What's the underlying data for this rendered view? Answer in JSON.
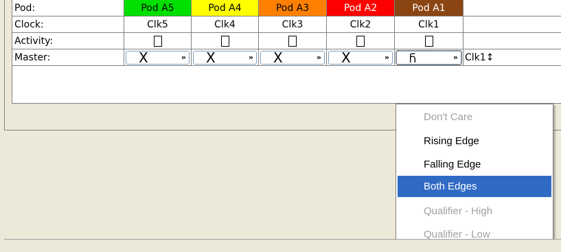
{
  "labels": {
    "pod": "Pod:",
    "clock": "Clock:",
    "activity": "Activity:",
    "master": "Master:"
  },
  "pods": [
    {
      "name": "Pod A5",
      "color": "#00e000",
      "clock": "Clk5",
      "master_glyph": "X",
      "chev": "»"
    },
    {
      "name": "Pod A4",
      "color": "#ffff00",
      "clock": "Clk4",
      "master_glyph": "X",
      "chev": "»"
    },
    {
      "name": "Pod A3",
      "color": "#ff8000",
      "clock": "Clk3",
      "master_glyph": "X",
      "chev": "»"
    },
    {
      "name": "Pod A2",
      "color": "#ff0000",
      "clock": "Clk2",
      "master_glyph": "X",
      "chev": "»"
    },
    {
      "name": "Pod A1",
      "color": "#8b4513",
      "clock": "Clk1",
      "master_glyph": "Ⴌ",
      "chev": "»"
    }
  ],
  "master_value": "Clk1↕",
  "menu": {
    "items": [
      {
        "label": "Don't Care",
        "state": "disabled"
      },
      {
        "label": "Rising Edge",
        "state": "normal"
      },
      {
        "label": "Falling Edge",
        "state": "normal"
      },
      {
        "label": "Both Edges",
        "state": "highlight"
      },
      {
        "label": "Qualifier - High",
        "state": "disabled"
      },
      {
        "label": "Qualifier - Low",
        "state": "disabled"
      }
    ]
  },
  "colors": {
    "pod_text_dark": "#000000",
    "pod_text_light": "#ffffff",
    "menu_highlight": "#316ac5"
  }
}
